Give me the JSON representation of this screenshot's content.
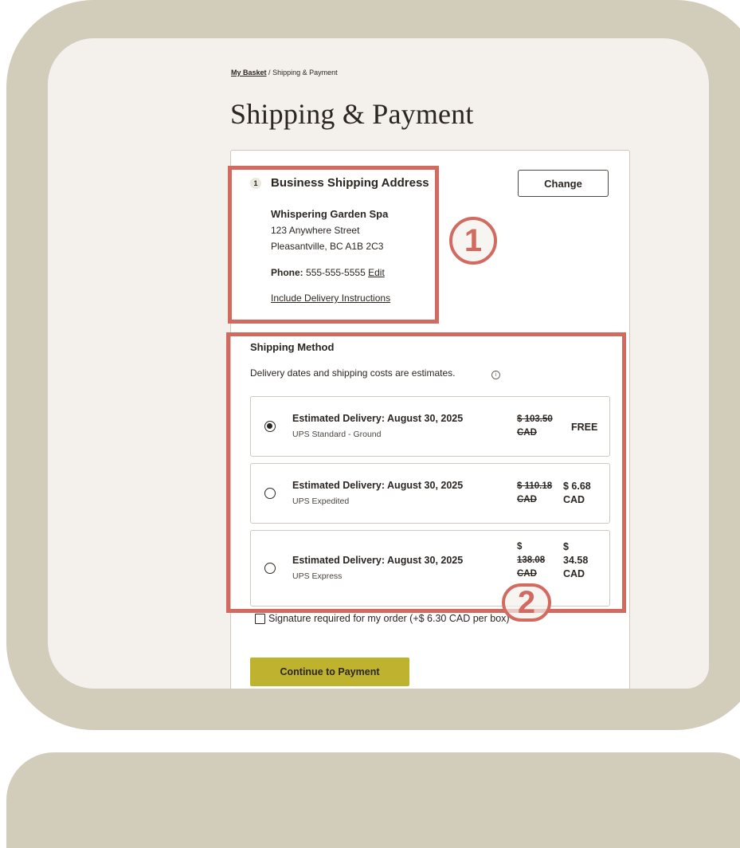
{
  "breadcrumb": {
    "basket": "My Basket",
    "separator": "/",
    "current": "Shipping & Payment"
  },
  "page_title": "Shipping & Payment",
  "address_section": {
    "step": "1",
    "title": "Business Shipping Address",
    "change_label": "Change",
    "name": "Whispering Garden Spa",
    "line1": "123 Anywhere Street",
    "line2": "Pleasantville, BC A1B 2C3",
    "phone_label": "Phone:",
    "phone": "555-555-5555",
    "edit_label": "Edit",
    "delivery_instructions": "Include Delivery Instructions"
  },
  "shipping": {
    "title": "Shipping Method",
    "note": "Delivery dates and shipping costs are estimates.",
    "info_icon": "i",
    "options": [
      {
        "title": "Estimated Delivery: August 30, 2025",
        "carrier": "UPS Standard - Ground",
        "old_price_1": "$ 103.50",
        "old_price_2": "CAD",
        "new_price_1": "FREE",
        "selected": true
      },
      {
        "title": "Estimated Delivery: August 30, 2025",
        "carrier": "UPS Expedited",
        "old_price_1": "$ 110.18",
        "old_price_2": "CAD",
        "new_price_1": "$ 6.68",
        "new_price_2": "CAD",
        "selected": false
      },
      {
        "title": "Estimated Delivery: August 30, 2025",
        "carrier": "UPS Express",
        "old_price_1": "$",
        "old_price_2": "138.08",
        "old_price_3": "CAD",
        "new_price_1": "$",
        "new_price_2": "34.58",
        "new_price_3": "CAD",
        "selected": false
      }
    ]
  },
  "signature_label": "Signature required for my order (+$ 6.30 CAD per box)",
  "continue_label": "Continue to Payment",
  "callouts": [
    "1",
    "2"
  ],
  "colors": {
    "frame": "#d2ccbb",
    "panel": "#f4f1ec",
    "highlight": "#d26a60",
    "button": "#bfb22e"
  }
}
